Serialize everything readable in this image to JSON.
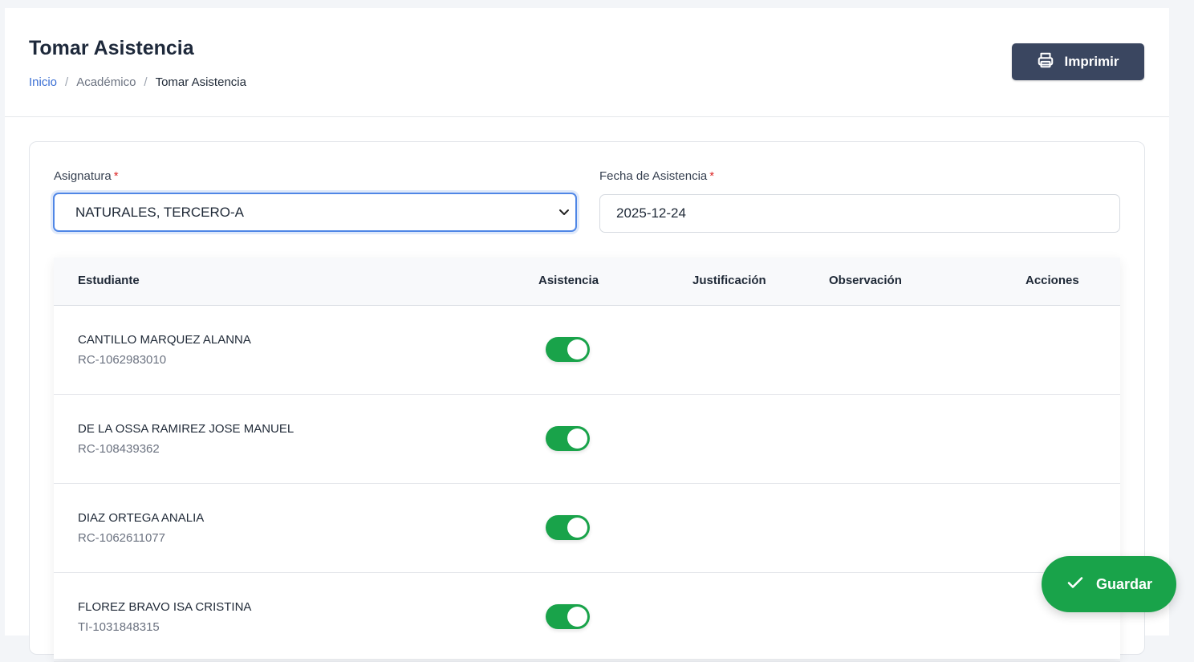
{
  "header": {
    "title": "Tomar Asistencia",
    "breadcrumb": [
      "Inicio",
      "Académico",
      "Tomar Asistencia"
    ],
    "print_label": "Imprimir"
  },
  "form": {
    "subject_label": "Asignatura",
    "subject_value": "NATURALES, TERCERO-A",
    "date_label": "Fecha de Asistencia",
    "date_value": "2025-12-24",
    "required_mark": "*"
  },
  "table": {
    "columns": [
      "Estudiante",
      "Asistencia",
      "Justificación",
      "Observación",
      "Acciones"
    ],
    "rows": [
      {
        "name": "CANTILLO MARQUEZ ALANNA",
        "doc": "RC-1062983010",
        "present": true
      },
      {
        "name": "DE LA OSSA RAMIREZ JOSE MANUEL",
        "doc": "RC-108439362",
        "present": true
      },
      {
        "name": "DIAZ ORTEGA ANALIA",
        "doc": "RC-1062611077",
        "present": true
      },
      {
        "name": "FLOREZ BRAVO ISA CRISTINA",
        "doc": "TI-1031848315",
        "present": true
      }
    ]
  },
  "actions": {
    "save_label": "Guardar"
  },
  "colors": {
    "primary_dark": "#3a4660",
    "success": "#19a34a",
    "link": "#3b6fd4",
    "focus": "#4f86e6"
  },
  "icons": {
    "print": "printer-icon",
    "save": "check-icon",
    "select": "chevron-down-icon"
  }
}
